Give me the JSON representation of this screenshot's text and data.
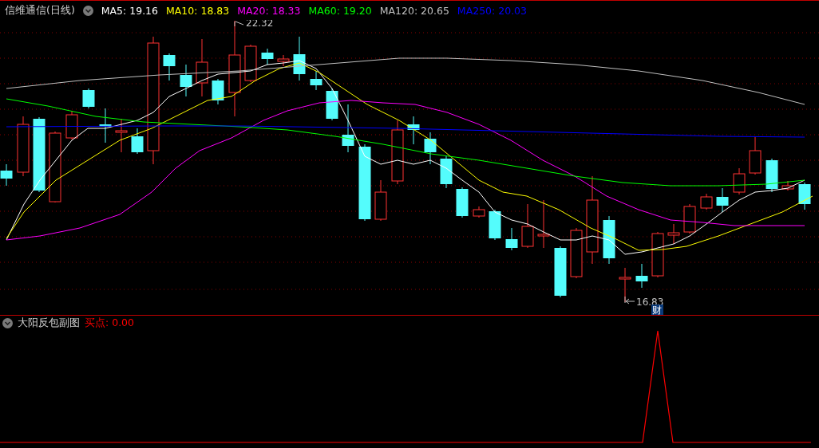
{
  "main_panel": {
    "title": "信维通信(日线)",
    "indicators": [
      {
        "label": "MA5: 19.16",
        "color": "#ffffff"
      },
      {
        "label": "MA10: 18.83",
        "color": "#ffff00"
      },
      {
        "label": "MA20: 18.33",
        "color": "#ff00ff"
      },
      {
        "label": "MA60: 19.20",
        "color": "#00ff00"
      },
      {
        "label": "MA120: 20.65",
        "color": "#c0c0c0"
      },
      {
        "label": "MA250: 20.03",
        "color": "#0000ff"
      }
    ],
    "high_label": "22.32",
    "low_label": "16.83",
    "badge": "财"
  },
  "sub_panel": {
    "title": "大阳反包副图",
    "indicators": [
      {
        "label": "买点: 0.00",
        "color": "#ff0000"
      }
    ]
  }
}
